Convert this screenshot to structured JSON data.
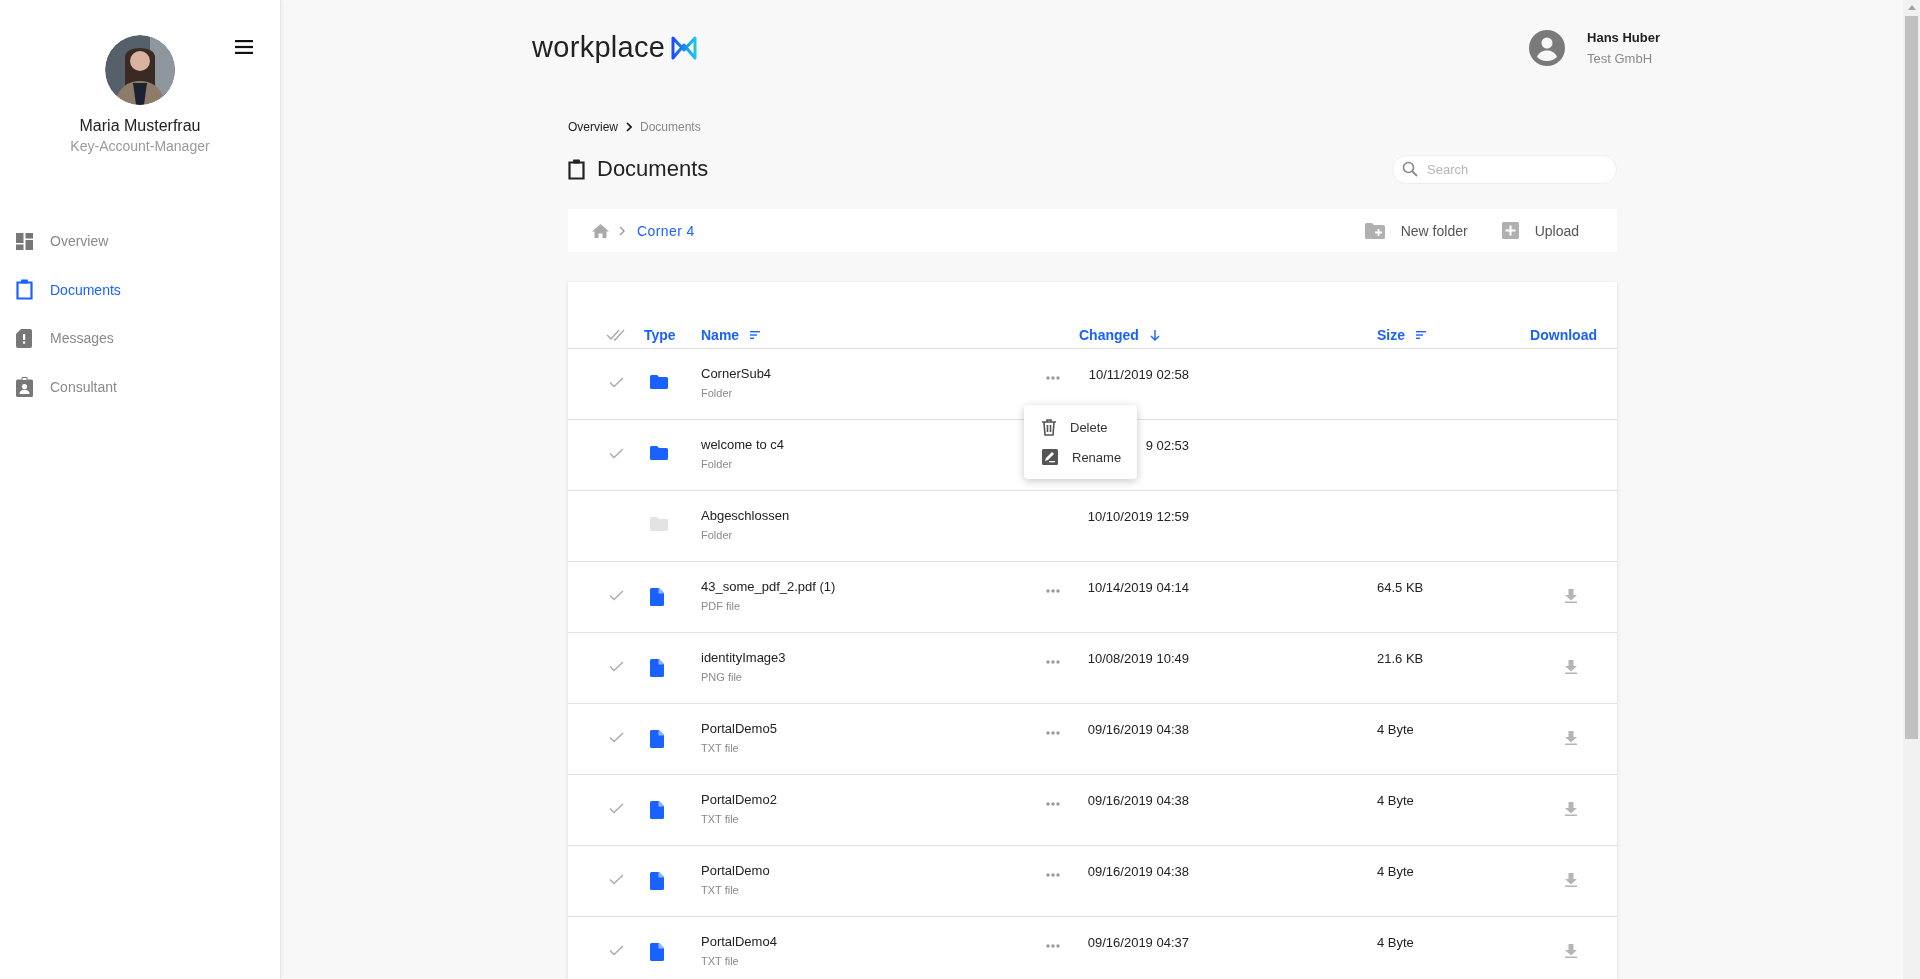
{
  "sidebar": {
    "user": {
      "name": "Maria Musterfrau",
      "role": "Key-Account-Manager"
    },
    "items": [
      {
        "label": "Overview",
        "kind": "dashboard",
        "selected": false
      },
      {
        "label": "Documents",
        "kind": "clipboard",
        "selected": true
      },
      {
        "label": "Messages",
        "kind": "message",
        "selected": false
      },
      {
        "label": "Consultant",
        "kind": "badge",
        "selected": false
      }
    ]
  },
  "header": {
    "logo": "workplace",
    "user": {
      "name": "Hans Huber",
      "company": "Test GmbH"
    }
  },
  "breadcrumb": [
    "Overview",
    "Documents"
  ],
  "page_title": "Documents",
  "search": {
    "placeholder": "Search"
  },
  "path": [
    "Corner 4"
  ],
  "actions": [
    {
      "label": "New folder",
      "kind": "new-folder"
    },
    {
      "label": "Upload",
      "kind": "upload"
    }
  ],
  "table": {
    "columns": [
      {
        "label": "Type",
        "kind": "plain"
      },
      {
        "label": "Name",
        "kind": "sortable"
      },
      {
        "label": "Changed",
        "kind": "sorted-descending"
      },
      {
        "label": "Size",
        "kind": "sortable"
      },
      {
        "label": "Download",
        "kind": "plain"
      }
    ],
    "rows": [
      {
        "name": "CornerSub4",
        "type": "Folder",
        "changed": "10/11/2019 02:58",
        "kind": "folder",
        "disabled": false,
        "menu": true,
        "context_menu": [
          {
            "label": "Delete",
            "kind": "delete"
          },
          {
            "label": "Rename",
            "kind": "rename"
          }
        ]
      },
      {
        "name": "welcome to c4",
        "type": "Folder",
        "changed": "9 02:53",
        "kind": "folder",
        "disabled": false,
        "menu": false
      },
      {
        "name": "Abgeschlossen",
        "type": "Folder",
        "changed": "10/10/2019 12:59",
        "kind": "folder",
        "disabled": true,
        "menu": false
      },
      {
        "name": "43_some_pdf_2.pdf (1)",
        "type": "PDF file",
        "changed": "10/14/2019 04:14",
        "size": "64.5 KB",
        "kind": "file",
        "disabled": false,
        "menu": true
      },
      {
        "name": "identityImage3",
        "type": "PNG file",
        "changed": "10/08/2019 10:49",
        "size": "21.6 KB",
        "kind": "file",
        "disabled": false,
        "menu": true
      },
      {
        "name": "PortalDemo5",
        "type": "TXT file",
        "changed": "09/16/2019 04:38",
        "size": "4 Byte",
        "kind": "file",
        "disabled": false,
        "menu": true
      },
      {
        "name": "PortalDemo2",
        "type": "TXT file",
        "changed": "09/16/2019 04:38",
        "size": "4 Byte",
        "kind": "file",
        "disabled": false,
        "menu": true
      },
      {
        "name": "PortalDemo",
        "type": "TXT file",
        "changed": "09/16/2019 04:38",
        "size": "4 Byte",
        "kind": "file",
        "disabled": false,
        "menu": true
      },
      {
        "name": "PortalDemo4",
        "type": "TXT file",
        "changed": "09/16/2019 04:37",
        "size": "4 Byte",
        "kind": "file",
        "disabled": false,
        "menu": true
      }
    ]
  }
}
